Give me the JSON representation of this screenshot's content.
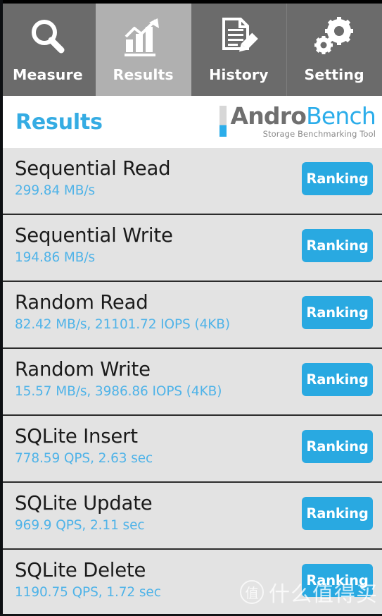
{
  "colors": {
    "accent_blue": "#29a9e1",
    "title_blue": "#35ace3",
    "subtitle_blue": "#4fb3e8",
    "tabbar_bg": "#6b6b6b",
    "tab_active_bg": "#b0b0b0",
    "row_bg": "#e3e3e3",
    "row_divider": "#2c2c2c",
    "brand_gray": "#6f6f6f"
  },
  "tabs": [
    {
      "label": "Measure",
      "icon": "magnifier-icon",
      "active": false
    },
    {
      "label": "Results",
      "icon": "bar-chart-trend-icon",
      "active": true
    },
    {
      "label": "History",
      "icon": "document-pencil-icon",
      "active": false
    },
    {
      "label": "Setting",
      "icon": "gears-icon",
      "active": false
    }
  ],
  "header": {
    "title": "Results",
    "brand": {
      "part1": "Andro",
      "part2": "Bench",
      "tagline": "Storage Benchmarking Tool"
    }
  },
  "results": {
    "button_label": "Ranking",
    "rows": [
      {
        "title": "Sequential Read",
        "value": "299.84 MB/s"
      },
      {
        "title": "Sequential Write",
        "value": "194.86 MB/s"
      },
      {
        "title": "Random Read",
        "value": "82.42 MB/s, 21101.72 IOPS (4KB)"
      },
      {
        "title": "Random Write",
        "value": "15.57 MB/s, 3986.86 IOPS (4KB)"
      },
      {
        "title": "SQLite Insert",
        "value": "778.59 QPS, 2.63 sec"
      },
      {
        "title": "SQLite Update",
        "value": "969.9 QPS, 2.11 sec"
      },
      {
        "title": "SQLite Delete",
        "value": "1190.75 QPS, 1.72 sec"
      }
    ]
  },
  "watermark": {
    "mark": "值",
    "text": "什么值得买"
  }
}
